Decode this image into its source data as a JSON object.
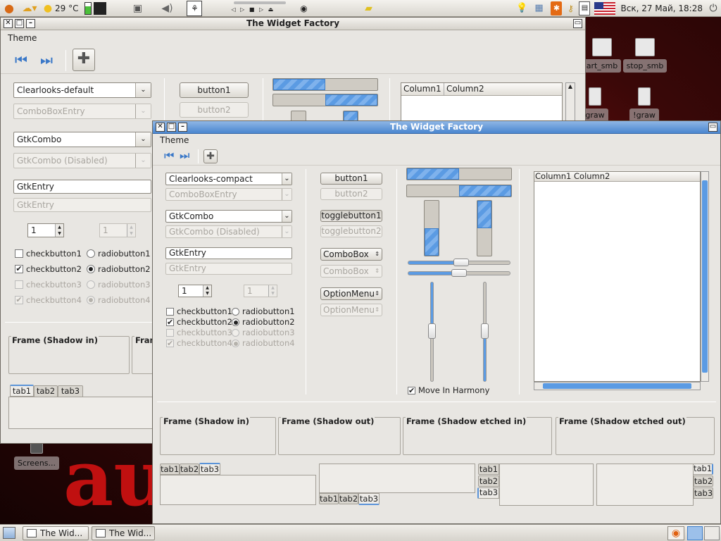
{
  "top_panel": {
    "temperature": "29 °C",
    "clock": "Вск, 27 Май, 18:28"
  },
  "desktop": {
    "icons": [
      {
        "label": "art_smb"
      },
      {
        "label": "stop_smb"
      },
      {
        "label": "graw"
      },
      {
        "label": "!graw"
      },
      {
        "label": "Screens..."
      }
    ]
  },
  "back_window": {
    "title": "The Widget Factory",
    "menu": "Theme",
    "combo_theme": "Clearlooks-default",
    "combo_entry": "ComboBoxEntry",
    "gtkcombo": "GtkCombo",
    "gtkcombo_disabled": "GtkCombo (Disabled)",
    "entry": "GtkEntry",
    "entry_disabled": "GtkEntry",
    "spin": "1",
    "spin_disabled": "1",
    "checks": [
      "checkbutton1",
      "checkbutton2",
      "checkbutton3",
      "checkbutton4"
    ],
    "radios": [
      "radiobutton1",
      "radiobutton2",
      "radiobutton3",
      "radiobutton4"
    ],
    "button1": "button1",
    "button2": "button2",
    "col1": "Column1",
    "col2": "Column2",
    "frame1": "Frame (Shadow in)",
    "frame2": "Fram",
    "tabs": [
      "tab1",
      "tab2",
      "tab3"
    ]
  },
  "front_window": {
    "title": "The Widget Factory",
    "menu": "Theme",
    "combo_theme": "Clearlooks-compact",
    "combo_entry": "ComboBoxEntry",
    "gtkcombo": "GtkCombo",
    "gtkcombo_disabled": "GtkCombo (Disabled)",
    "entry": "GtkEntry",
    "entry_disabled": "GtkEntry",
    "spin": "1",
    "spin_disabled": "1",
    "checks": [
      "checkbutton1",
      "checkbutton2",
      "checkbutton3",
      "checkbutton4"
    ],
    "radios": [
      "radiobutton1",
      "radiobutton2",
      "radiobutton3",
      "radiobutton4"
    ],
    "button1": "button1",
    "button2": "button2",
    "toggle1": "togglebutton1",
    "toggle2": "togglebutton2",
    "combobox": "ComboBox",
    "combobox_disabled": "ComboBox",
    "optionmenu": "OptionMenu",
    "optionmenu_disabled": "OptionMenu",
    "move_in_harmony": "Move In Harmony",
    "col1": "Column1",
    "col2": "Column2",
    "frames": [
      "Frame (Shadow in)",
      "Frame (Shadow out)",
      "Frame (Shadow etched in)",
      "Frame (Shadow etched out)"
    ],
    "tabs": [
      "tab1",
      "tab2",
      "tab3"
    ]
  },
  "taskbar": {
    "items": [
      "The Wid...",
      "The Wid..."
    ]
  }
}
